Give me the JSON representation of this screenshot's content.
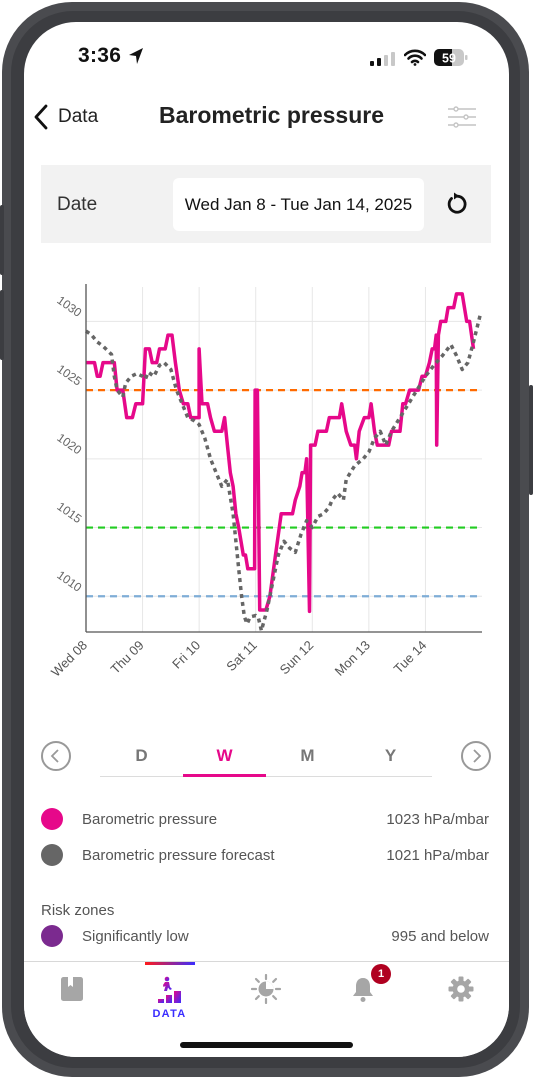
{
  "status_bar": {
    "time": "3:36",
    "battery_level": "59",
    "signal_bars_active": 2,
    "signal_bars_total": 4
  },
  "nav": {
    "back_label": "Data",
    "title": "Barometric pressure"
  },
  "date_filter": {
    "label": "Date",
    "value": "Wed Jan 8 - Tue Jan 14, 2025"
  },
  "range_tabs": [
    {
      "label": "D",
      "active": false
    },
    {
      "label": "W",
      "active": true
    },
    {
      "label": "M",
      "active": false
    },
    {
      "label": "Y",
      "active": false
    }
  ],
  "legend": [
    {
      "label": "Barometric pressure",
      "value": "1023 hPa/mbar",
      "color": "#e6088a"
    },
    {
      "label": "Barometric pressure forecast",
      "value": "1021 hPa/mbar",
      "color": "#666666"
    }
  ],
  "risk_zones": {
    "title": "Risk zones",
    "items": [
      {
        "label": "Significantly low",
        "value": "995 and below",
        "color": "#7b2a8f"
      }
    ]
  },
  "tab_bar": {
    "items": [
      {
        "name": "journal",
        "label": "",
        "active": false
      },
      {
        "name": "data",
        "label": "DATA",
        "active": true
      },
      {
        "name": "weather",
        "label": "",
        "active": false
      },
      {
        "name": "notifications",
        "label": "",
        "active": false,
        "badge": "1"
      },
      {
        "name": "settings",
        "label": "",
        "active": false
      }
    ]
  },
  "chart_data": {
    "type": "line",
    "title": "",
    "xlabel": "",
    "ylabel": "",
    "x_unit": "days since Wed 08",
    "x_ticks": [
      "Wed 08",
      "Thu 09",
      "Fri 10",
      "Sat 11",
      "Sun 12",
      "Mon 13",
      "Tue 14"
    ],
    "xlim": [
      0,
      7
    ],
    "y_ticks": [
      1010,
      1015,
      1020,
      1025,
      1030
    ],
    "ylim": [
      1007.4,
      1032.5
    ],
    "grid": true,
    "threshold_lines": [
      {
        "value": 1025,
        "color": "#ff6a00"
      },
      {
        "value": 1015,
        "color": "#22cc22"
      },
      {
        "value": 1010,
        "color": "#7fadd6"
      }
    ],
    "series": [
      {
        "name": "Barometric pressure",
        "color": "#e6088a",
        "style": "solid",
        "points": [
          [
            0.0,
            1027
          ],
          [
            0.15,
            1027
          ],
          [
            0.2,
            1026
          ],
          [
            0.25,
            1026
          ],
          [
            0.3,
            1027
          ],
          [
            0.5,
            1027
          ],
          [
            0.55,
            1025
          ],
          [
            0.65,
            1025
          ],
          [
            0.72,
            1023
          ],
          [
            0.82,
            1023
          ],
          [
            0.88,
            1024
          ],
          [
            1.0,
            1024
          ],
          [
            1.05,
            1028
          ],
          [
            1.12,
            1028
          ],
          [
            1.17,
            1027
          ],
          [
            1.25,
            1027
          ],
          [
            1.3,
            1028
          ],
          [
            1.4,
            1028
          ],
          [
            1.45,
            1029
          ],
          [
            1.52,
            1029
          ],
          [
            1.58,
            1027
          ],
          [
            1.65,
            1025
          ],
          [
            1.72,
            1024
          ],
          [
            1.8,
            1024
          ],
          [
            1.85,
            1023
          ],
          [
            1.95,
            1023
          ],
          [
            2.0,
            1023
          ],
          [
            2.0,
            1028
          ],
          [
            2.05,
            1024
          ],
          [
            2.15,
            1024
          ],
          [
            2.2,
            1023
          ],
          [
            2.27,
            1022
          ],
          [
            2.4,
            1022
          ],
          [
            2.45,
            1023
          ],
          [
            2.5,
            1021
          ],
          [
            2.55,
            1019
          ],
          [
            2.6,
            1018
          ],
          [
            2.65,
            1016
          ],
          [
            2.7,
            1015
          ],
          [
            2.78,
            1013
          ],
          [
            2.82,
            1013
          ],
          [
            2.86,
            1012
          ],
          [
            2.98,
            1012
          ],
          [
            2.99,
            1025
          ],
          [
            3.03,
            1025
          ],
          [
            3.07,
            1009
          ],
          [
            3.18,
            1009
          ],
          [
            3.25,
            1010
          ],
          [
            3.35,
            1013
          ],
          [
            3.45,
            1016
          ],
          [
            3.65,
            1016
          ],
          [
            3.7,
            1017
          ],
          [
            3.78,
            1018
          ],
          [
            3.82,
            1019
          ],
          [
            3.87,
            1019
          ],
          [
            3.9,
            1020
          ],
          [
            3.95,
            1008.9
          ],
          [
            3.97,
            1021
          ],
          [
            4.05,
            1021
          ],
          [
            4.1,
            1022
          ],
          [
            4.25,
            1022
          ],
          [
            4.3,
            1023
          ],
          [
            4.48,
            1023
          ],
          [
            4.52,
            1024
          ],
          [
            4.6,
            1022
          ],
          [
            4.68,
            1021
          ],
          [
            4.75,
            1021
          ],
          [
            4.78,
            1020
          ],
          [
            4.83,
            1022
          ],
          [
            4.92,
            1023
          ],
          [
            5.0,
            1023
          ],
          [
            5.04,
            1024
          ],
          [
            5.1,
            1022
          ],
          [
            5.15,
            1021
          ],
          [
            5.35,
            1021
          ],
          [
            5.4,
            1022
          ],
          [
            5.55,
            1022
          ],
          [
            5.6,
            1024
          ],
          [
            5.65,
            1024
          ],
          [
            5.72,
            1025
          ],
          [
            5.88,
            1025
          ],
          [
            5.94,
            1026
          ],
          [
            6.0,
            1026
          ],
          [
            6.07,
            1027
          ],
          [
            6.12,
            1028
          ],
          [
            6.16,
            1028
          ],
          [
            6.19,
            1029
          ],
          [
            6.2,
            1021
          ],
          [
            6.23,
            1029
          ],
          [
            6.27,
            1030
          ],
          [
            6.36,
            1030
          ],
          [
            6.4,
            1031
          ],
          [
            6.5,
            1031
          ],
          [
            6.55,
            1032
          ],
          [
            6.65,
            1032
          ],
          [
            6.73,
            1030
          ],
          [
            6.78,
            1030
          ],
          [
            6.85,
            1028
          ]
        ]
      },
      {
        "name": "Barometric pressure forecast",
        "color": "#666666",
        "style": "dotted",
        "points": [
          [
            0.0,
            1029.3
          ],
          [
            0.1,
            1029
          ],
          [
            0.2,
            1028.5
          ],
          [
            0.3,
            1028.2
          ],
          [
            0.4,
            1027.8
          ],
          [
            0.45,
            1027.6
          ],
          [
            0.5,
            1026
          ],
          [
            0.55,
            1025
          ],
          [
            0.65,
            1024.5
          ],
          [
            0.7,
            1025.5
          ],
          [
            0.8,
            1026
          ],
          [
            0.9,
            1026.2
          ],
          [
            1.0,
            1026
          ],
          [
            1.05,
            1025.8
          ],
          [
            1.1,
            1026.3
          ],
          [
            1.2,
            1026
          ],
          [
            1.3,
            1026.8
          ],
          [
            1.38,
            1027
          ],
          [
            1.5,
            1026.5
          ],
          [
            1.6,
            1025
          ],
          [
            1.7,
            1024
          ],
          [
            1.8,
            1023
          ],
          [
            1.9,
            1022.8
          ],
          [
            2.0,
            1022.5
          ],
          [
            2.1,
            1021.5
          ],
          [
            2.2,
            1020
          ],
          [
            2.3,
            1019
          ],
          [
            2.4,
            1018
          ],
          [
            2.5,
            1018.5
          ],
          [
            2.6,
            1016
          ],
          [
            2.7,
            1012
          ],
          [
            2.75,
            1010
          ],
          [
            2.8,
            1008.5
          ],
          [
            2.85,
            1008
          ],
          [
            2.9,
            1008.5
          ],
          [
            3.0,
            1008.6
          ],
          [
            3.05,
            1008.4
          ],
          [
            3.1,
            1007.5
          ],
          [
            3.2,
            1009
          ],
          [
            3.3,
            1011
          ],
          [
            3.4,
            1013
          ],
          [
            3.5,
            1014
          ],
          [
            3.6,
            1013.5
          ],
          [
            3.7,
            1013.2
          ],
          [
            3.8,
            1014.5
          ],
          [
            3.9,
            1015.5
          ],
          [
            4.0,
            1015
          ],
          [
            4.1,
            1015.8
          ],
          [
            4.2,
            1016
          ],
          [
            4.3,
            1016.5
          ],
          [
            4.35,
            1017
          ],
          [
            4.45,
            1017.5
          ],
          [
            4.55,
            1017
          ],
          [
            4.6,
            1018.5
          ],
          [
            4.75,
            1019.5
          ],
          [
            4.9,
            1020
          ],
          [
            5.0,
            1020.5
          ],
          [
            5.1,
            1021.5
          ],
          [
            5.2,
            1022
          ],
          [
            5.3,
            1021
          ],
          [
            5.4,
            1022
          ],
          [
            5.55,
            1023
          ],
          [
            5.7,
            1024
          ],
          [
            5.85,
            1025
          ],
          [
            6.0,
            1026
          ],
          [
            6.15,
            1026.8
          ],
          [
            6.3,
            1027.5
          ],
          [
            6.45,
            1028.3
          ],
          [
            6.55,
            1027.5
          ],
          [
            6.65,
            1026.5
          ],
          [
            6.75,
            1027
          ],
          [
            6.85,
            1028.5
          ],
          [
            6.97,
            1030.5
          ]
        ]
      }
    ]
  }
}
